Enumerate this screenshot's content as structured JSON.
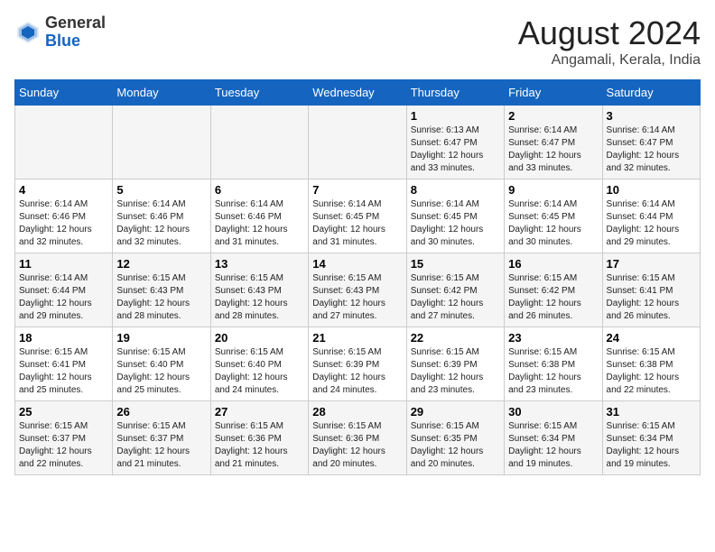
{
  "header": {
    "logo_general": "General",
    "logo_blue": "Blue",
    "month_year": "August 2024",
    "location": "Angamali, Kerala, India"
  },
  "days_of_week": [
    "Sunday",
    "Monday",
    "Tuesday",
    "Wednesday",
    "Thursday",
    "Friday",
    "Saturday"
  ],
  "weeks": [
    [
      {
        "day": "",
        "info": ""
      },
      {
        "day": "",
        "info": ""
      },
      {
        "day": "",
        "info": ""
      },
      {
        "day": "",
        "info": ""
      },
      {
        "day": "1",
        "info": "Sunrise: 6:13 AM\nSunset: 6:47 PM\nDaylight: 12 hours\nand 33 minutes."
      },
      {
        "day": "2",
        "info": "Sunrise: 6:14 AM\nSunset: 6:47 PM\nDaylight: 12 hours\nand 33 minutes."
      },
      {
        "day": "3",
        "info": "Sunrise: 6:14 AM\nSunset: 6:47 PM\nDaylight: 12 hours\nand 32 minutes."
      }
    ],
    [
      {
        "day": "4",
        "info": "Sunrise: 6:14 AM\nSunset: 6:46 PM\nDaylight: 12 hours\nand 32 minutes."
      },
      {
        "day": "5",
        "info": "Sunrise: 6:14 AM\nSunset: 6:46 PM\nDaylight: 12 hours\nand 32 minutes."
      },
      {
        "day": "6",
        "info": "Sunrise: 6:14 AM\nSunset: 6:46 PM\nDaylight: 12 hours\nand 31 minutes."
      },
      {
        "day": "7",
        "info": "Sunrise: 6:14 AM\nSunset: 6:45 PM\nDaylight: 12 hours\nand 31 minutes."
      },
      {
        "day": "8",
        "info": "Sunrise: 6:14 AM\nSunset: 6:45 PM\nDaylight: 12 hours\nand 30 minutes."
      },
      {
        "day": "9",
        "info": "Sunrise: 6:14 AM\nSunset: 6:45 PM\nDaylight: 12 hours\nand 30 minutes."
      },
      {
        "day": "10",
        "info": "Sunrise: 6:14 AM\nSunset: 6:44 PM\nDaylight: 12 hours\nand 29 minutes."
      }
    ],
    [
      {
        "day": "11",
        "info": "Sunrise: 6:14 AM\nSunset: 6:44 PM\nDaylight: 12 hours\nand 29 minutes."
      },
      {
        "day": "12",
        "info": "Sunrise: 6:15 AM\nSunset: 6:43 PM\nDaylight: 12 hours\nand 28 minutes."
      },
      {
        "day": "13",
        "info": "Sunrise: 6:15 AM\nSunset: 6:43 PM\nDaylight: 12 hours\nand 28 minutes."
      },
      {
        "day": "14",
        "info": "Sunrise: 6:15 AM\nSunset: 6:43 PM\nDaylight: 12 hours\nand 27 minutes."
      },
      {
        "day": "15",
        "info": "Sunrise: 6:15 AM\nSunset: 6:42 PM\nDaylight: 12 hours\nand 27 minutes."
      },
      {
        "day": "16",
        "info": "Sunrise: 6:15 AM\nSunset: 6:42 PM\nDaylight: 12 hours\nand 26 minutes."
      },
      {
        "day": "17",
        "info": "Sunrise: 6:15 AM\nSunset: 6:41 PM\nDaylight: 12 hours\nand 26 minutes."
      }
    ],
    [
      {
        "day": "18",
        "info": "Sunrise: 6:15 AM\nSunset: 6:41 PM\nDaylight: 12 hours\nand 25 minutes."
      },
      {
        "day": "19",
        "info": "Sunrise: 6:15 AM\nSunset: 6:40 PM\nDaylight: 12 hours\nand 25 minutes."
      },
      {
        "day": "20",
        "info": "Sunrise: 6:15 AM\nSunset: 6:40 PM\nDaylight: 12 hours\nand 24 minutes."
      },
      {
        "day": "21",
        "info": "Sunrise: 6:15 AM\nSunset: 6:39 PM\nDaylight: 12 hours\nand 24 minutes."
      },
      {
        "day": "22",
        "info": "Sunrise: 6:15 AM\nSunset: 6:39 PM\nDaylight: 12 hours\nand 23 minutes."
      },
      {
        "day": "23",
        "info": "Sunrise: 6:15 AM\nSunset: 6:38 PM\nDaylight: 12 hours\nand 23 minutes."
      },
      {
        "day": "24",
        "info": "Sunrise: 6:15 AM\nSunset: 6:38 PM\nDaylight: 12 hours\nand 22 minutes."
      }
    ],
    [
      {
        "day": "25",
        "info": "Sunrise: 6:15 AM\nSunset: 6:37 PM\nDaylight: 12 hours\nand 22 minutes."
      },
      {
        "day": "26",
        "info": "Sunrise: 6:15 AM\nSunset: 6:37 PM\nDaylight: 12 hours\nand 21 minutes."
      },
      {
        "day": "27",
        "info": "Sunrise: 6:15 AM\nSunset: 6:36 PM\nDaylight: 12 hours\nand 21 minutes."
      },
      {
        "day": "28",
        "info": "Sunrise: 6:15 AM\nSunset: 6:36 PM\nDaylight: 12 hours\nand 20 minutes."
      },
      {
        "day": "29",
        "info": "Sunrise: 6:15 AM\nSunset: 6:35 PM\nDaylight: 12 hours\nand 20 minutes."
      },
      {
        "day": "30",
        "info": "Sunrise: 6:15 AM\nSunset: 6:34 PM\nDaylight: 12 hours\nand 19 minutes."
      },
      {
        "day": "31",
        "info": "Sunrise: 6:15 AM\nSunset: 6:34 PM\nDaylight: 12 hours\nand 19 minutes."
      }
    ]
  ]
}
